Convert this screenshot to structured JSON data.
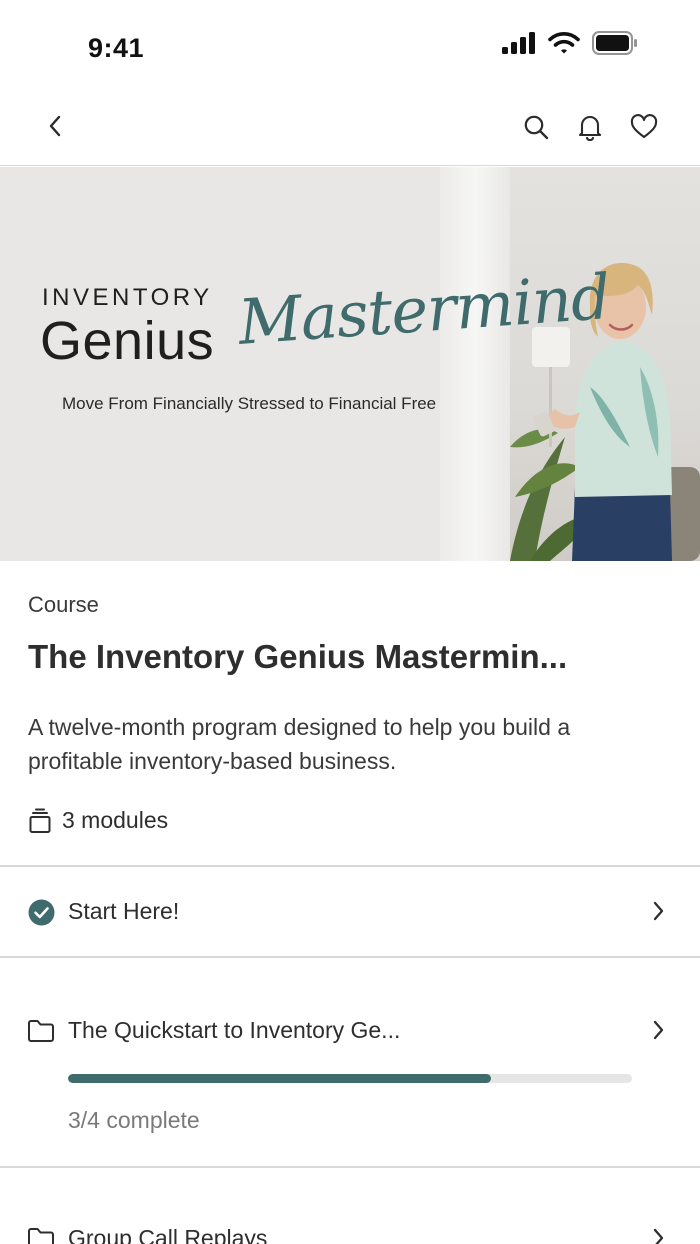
{
  "status_bar": {
    "time": "9:41",
    "icons": [
      "cellular-signal-icon",
      "wifi-icon",
      "battery-icon"
    ]
  },
  "nav": {
    "back_icon": "chevron-left-icon",
    "actions": [
      "search-icon",
      "bell-icon",
      "heart-icon"
    ]
  },
  "hero": {
    "brand_top": "INVENTORY",
    "brand_big": "Genius",
    "script": "Mastermind",
    "tagline": "Move From Financially Stressed to Financial Free"
  },
  "course": {
    "eyebrow": "Course",
    "title": "The Inventory Genius Mastermin...",
    "description": "A twelve-month program designed to help you build a profitable inventory-based business.",
    "modules_label": "3 modules"
  },
  "modules": [
    {
      "label": "Start Here!",
      "icon": "check-circle-icon",
      "completed": true
    },
    {
      "label": "The Quickstart to Inventory Ge...",
      "icon": "folder-icon",
      "progress": 0.75,
      "progress_text": "3/4 complete"
    },
    {
      "label": "Group Call Replays",
      "icon": "folder-icon"
    }
  ],
  "colors": {
    "accent": "#3f6b6c",
    "progress_track": "#e6e6e6",
    "divider": "#d9d9d9"
  }
}
